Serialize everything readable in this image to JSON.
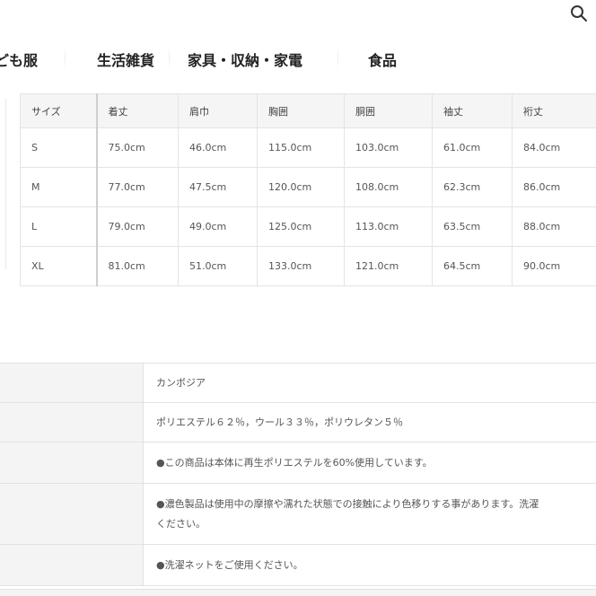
{
  "header": {
    "search_icon": "search-icon"
  },
  "nav": {
    "items": [
      {
        "label": "ども服"
      },
      {
        "label": "生活雑貨"
      },
      {
        "label": "家具・収納・家電"
      },
      {
        "label": "食品"
      }
    ]
  },
  "size_table": {
    "headers": [
      "サイズ",
      "着丈",
      "肩巾",
      "胸囲",
      "胴囲",
      "袖丈",
      "裄丈"
    ],
    "rows": [
      [
        "S",
        "75.0cm",
        "46.0cm",
        "115.0cm",
        "103.0cm",
        "61.0cm",
        "84.0cm"
      ],
      [
        "M",
        "77.0cm",
        "47.5cm",
        "120.0cm",
        "108.0cm",
        "62.3cm",
        "86.0cm"
      ],
      [
        "L",
        "79.0cm",
        "49.0cm",
        "125.0cm",
        "113.0cm",
        "63.5cm",
        "88.0cm"
      ],
      [
        "XL",
        "81.0cm",
        "51.0cm",
        "133.0cm",
        "121.0cm",
        "64.5cm",
        "90.0cm"
      ]
    ]
  },
  "info": {
    "origin": "カンボジア",
    "material": "ポリエステル６２％，ウール３３％，ポリウレタン５％",
    "note_recycled": "●この商品は本体に再生ポリエステルを60%使用しています。",
    "note_color_line1": "●濃色製品は使用中の摩擦や濡れた状態での接触により色移りする事があります。洗濯",
    "note_color_line2": "ください。",
    "note_laundry": "●洗濯ネットをご使用ください。"
  }
}
